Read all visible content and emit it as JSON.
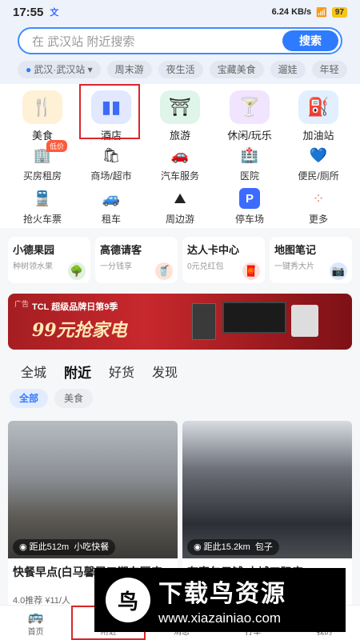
{
  "status": {
    "time": "17:55",
    "net": "6.24 KB/s",
    "battery": "97"
  },
  "search": {
    "placeholder": "在 武汉站 附近搜索",
    "button": "搜索"
  },
  "chips": [
    "武汉·武汉站",
    "周末游",
    "夜生活",
    "宝藏美食",
    "遛娃",
    "年轻"
  ],
  "big_services": [
    {
      "label": "美食",
      "icon": "fork-knife-icon",
      "glyph": "🍴",
      "bg": "#fff1d6"
    },
    {
      "label": "酒店",
      "icon": "hotel-icon",
      "glyph": "🏨",
      "bg": "#e1e8ff"
    },
    {
      "label": "旅游",
      "icon": "gate-icon",
      "glyph": "⛩",
      "bg": "#dff5ea"
    },
    {
      "label": "休闲/玩乐",
      "icon": "cocktail-icon",
      "glyph": "🍸",
      "bg": "#f0e4ff"
    },
    {
      "label": "加油站",
      "icon": "gas-pump-icon",
      "glyph": "⛽",
      "bg": "#e1efff"
    }
  ],
  "small_services": [
    {
      "label": "买房租房",
      "icon": "building-icon",
      "glyph": "🏢"
    },
    {
      "label": "商场/超市",
      "icon": "shopping-bag-icon",
      "glyph": "🛍"
    },
    {
      "label": "汽车服务",
      "icon": "car-icon",
      "glyph": "🚗"
    },
    {
      "label": "医院",
      "icon": "hospital-icon",
      "glyph": "🏥"
    },
    {
      "label": "便民/厕所",
      "icon": "heart-hand-icon",
      "glyph": "💙"
    },
    {
      "label": "抢火车票",
      "icon": "train-icon",
      "glyph": "🚆"
    },
    {
      "label": "租车",
      "icon": "rental-car-icon",
      "glyph": "🚙"
    },
    {
      "label": "周边游",
      "icon": "mountain-icon",
      "glyph": "⛰"
    },
    {
      "label": "停车场",
      "icon": "parking-icon",
      "glyph": "🅿"
    },
    {
      "label": "更多",
      "icon": "more-dots-icon",
      "glyph": "⁘"
    }
  ],
  "badge_lowprice": "低价",
  "mini_cards": [
    {
      "title": "小德果园",
      "sub": "种树领水果",
      "icon": "tree-icon",
      "glyph": "🌳",
      "color": "#dff1df"
    },
    {
      "title": "高德请客",
      "sub": "一分钱享",
      "icon": "drink-icon",
      "glyph": "🥤",
      "color": "#ffe2d6"
    },
    {
      "title": "达人卡中心",
      "sub": "0元兑红包",
      "icon": "red-packet-icon",
      "glyph": "🧧",
      "color": "#ffdcd9"
    },
    {
      "title": "地图笔记",
      "sub": "一键秀大片",
      "icon": "camera-icon",
      "glyph": "📷",
      "color": "#dde8ff"
    }
  ],
  "ad": {
    "tag": "广告",
    "title": "TCL 超级品牌日第9季",
    "slogan": "99元抢家电"
  },
  "tabs": [
    "全城",
    "附近",
    "好货",
    "发现"
  ],
  "subtabs": [
    "全部",
    "美食"
  ],
  "feed": [
    {
      "distance": "距此512m",
      "category": "小吃快餐",
      "title": "快餐早点(白马馨居三期东区店)",
      "meta": "4.0推荐 ¥11/人"
    },
    {
      "distance": "距此15.2km",
      "category": "包子",
      "title": "有家包子铺(水城工际店)",
      "meta": ""
    }
  ],
  "nav": [
    {
      "label": "首页",
      "icon": "bus-icon",
      "glyph": "🚌"
    },
    {
      "label": "附近",
      "icon": "nearby-icon",
      "glyph": "◎"
    },
    {
      "label": "消息",
      "icon": "message-icon",
      "glyph": "✉"
    },
    {
      "label": "打车",
      "icon": "taxi-icon",
      "glyph": "🚕"
    },
    {
      "label": "我的",
      "icon": "user-icon",
      "glyph": "👤"
    }
  ],
  "watermark": {
    "text": "下载鸟资源",
    "url": "www.xiazainiao.com"
  }
}
